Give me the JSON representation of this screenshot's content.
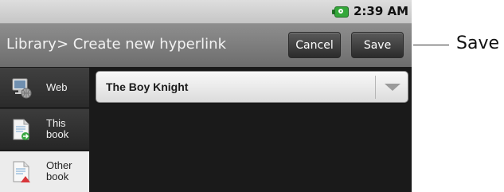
{
  "status_bar": {
    "time": "2:39 AM",
    "battery_icon": "battery-charging-icon"
  },
  "title_bar": {
    "title": "Library> Create new hyperlink",
    "cancel_label": "Cancel",
    "save_label": "Save"
  },
  "sidebar": {
    "items": [
      {
        "label": "Web",
        "icon": "monitor-icon",
        "selected": false
      },
      {
        "label": "This\nbook",
        "icon": "book-page-icon",
        "selected": false
      },
      {
        "label": "Other\nbook",
        "icon": "other-book-icon",
        "selected": true
      }
    ]
  },
  "link_target": {
    "selected_value": "The Boy Knight"
  },
  "callout": {
    "label": "Save"
  },
  "colors": {
    "battery": "#34a83a",
    "selected_tab": "#ececec",
    "title_bar": "#7d7d7d"
  }
}
